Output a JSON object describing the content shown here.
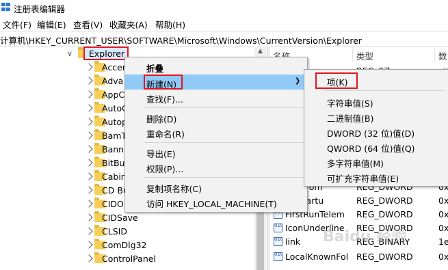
{
  "window": {
    "title": "注册表编辑器"
  },
  "menubar": [
    {
      "label": "文件(F)"
    },
    {
      "label": "编辑(E)"
    },
    {
      "label": "查看(V)"
    },
    {
      "label": "收藏夹(A)"
    },
    {
      "label": "帮助(H)"
    }
  ],
  "address": "计算机\\HKEY_CURRENT_USER\\SOFTWARE\\Microsoft\\Windows\\CurrentVersion\\Explorer",
  "tree": {
    "selected": "Explorer",
    "children": [
      "Accer",
      "Adva",
      "AppC",
      "AutoC",
      "Autop",
      "BamT",
      "Bann",
      "BitBu",
      "Cabin",
      "CD Bu",
      "CIDO",
      "CIDSave",
      "CLSID",
      "ComDlg32",
      "ControlPanel"
    ]
  },
  "list": {
    "headers": [
      "名称",
      "类型",
      "数"
    ],
    "rows": [
      {
        "name": "",
        "type": "REG_SZ",
        "data": "(数"
      },
      {
        "name": "nedFrom",
        "type": "REG_DWORD",
        "data": "0x"
      },
      {
        "name": "rerStartu",
        "type": "REG_DWORD",
        "data": "0x"
      },
      {
        "name": "FirstRunTelem",
        "type": "REG_DWORD",
        "data": "0x"
      },
      {
        "name": "IconUnderline",
        "type": "REG_DWORD",
        "data": "0x"
      },
      {
        "name": "link",
        "type": "REG_BINARY",
        "data": "1e"
      },
      {
        "name": "LocalKnownFol",
        "type": "REG_DWORD",
        "data": "0x"
      }
    ]
  },
  "context_menu": {
    "items": [
      {
        "label": "折叠"
      },
      {
        "label": "新建(N)"
      },
      {
        "label": "查找(F)..."
      },
      {
        "label": "删除(D)"
      },
      {
        "label": "重命名(R)"
      },
      {
        "label": "导出(E)"
      },
      {
        "label": "权限(P)..."
      },
      {
        "label": "复制项名称(C)"
      },
      {
        "label": "访问 HKEY_LOCAL_MACHINE(T)"
      }
    ]
  },
  "submenu": {
    "items": [
      {
        "label": "项(K)"
      },
      {
        "label": "字符串值(S)"
      },
      {
        "label": "二进制值(B)"
      },
      {
        "label": "DWORD (32 位)值(D)"
      },
      {
        "label": "QWORD (64 位)值(Q)"
      },
      {
        "label": "多字符串值(M)"
      },
      {
        "label": "可扩充字符串值(E)"
      }
    ]
  },
  "watermark": "Baidu 经验",
  "colors": {
    "highlight": "#e0161e",
    "hover": "#91c9f7",
    "folder": "#f6cf5b"
  }
}
